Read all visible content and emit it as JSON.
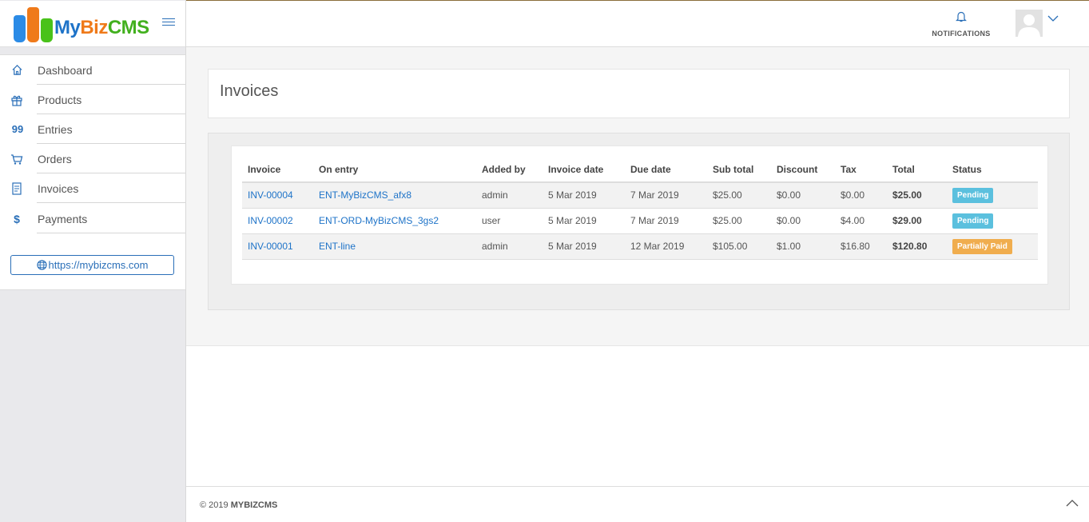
{
  "brand": {
    "my": "My",
    "biz": "Biz",
    "cms": "CMS"
  },
  "sidebar": {
    "items": [
      {
        "label": "Dashboard",
        "icon": "home-icon",
        "glyph": ""
      },
      {
        "label": "Products",
        "icon": "gift-icon",
        "glyph": ""
      },
      {
        "label": "Entries",
        "icon": "quote-icon",
        "glyph": "99"
      },
      {
        "label": "Orders",
        "icon": "cart-icon",
        "glyph": ""
      },
      {
        "label": "Invoices",
        "icon": "document-icon",
        "glyph": ""
      },
      {
        "label": "Payments",
        "icon": "dollar-icon",
        "glyph": "$"
      }
    ],
    "site_link": "https://mybizcms.com"
  },
  "header": {
    "notifications_label": "NOTIFICATIONS"
  },
  "page": {
    "title": "Invoices"
  },
  "table": {
    "headers": [
      "Invoice",
      "On entry",
      "Added by",
      "Invoice date",
      "Due date",
      "Sub total",
      "Discount",
      "Tax",
      "Total",
      "Status"
    ],
    "rows": [
      {
        "invoice": "INV-00004",
        "entry": "ENT-MyBizCMS_afx8",
        "added_by": "admin",
        "invoice_date": "5 Mar 2019",
        "due_date": "7 Mar 2019",
        "sub_total": "$25.00",
        "discount": "$0.00",
        "tax": "$0.00",
        "total": "$25.00",
        "status": "Pending"
      },
      {
        "invoice": "INV-00002",
        "entry": "ENT-ORD-MyBizCMS_3gs2",
        "added_by": "user",
        "invoice_date": "5 Mar 2019",
        "due_date": "7 Mar 2019",
        "sub_total": "$25.00",
        "discount": "$0.00",
        "tax": "$4.00",
        "total": "$29.00",
        "status": "Pending"
      },
      {
        "invoice": "INV-00001",
        "entry": "ENT-line",
        "added_by": "admin",
        "invoice_date": "5 Mar 2019",
        "due_date": "12 Mar 2019",
        "sub_total": "$105.00",
        "discount": "$1.00",
        "tax": "$16.80",
        "total": "$120.80",
        "status": "Partially Paid"
      }
    ]
  },
  "colors": {
    "accent": "#1e73c8",
    "pending": "#5bc0de",
    "partially_paid": "#f0ad4e"
  },
  "footer": {
    "copyright": "© 2019",
    "brand": "MYBIZCMS"
  }
}
